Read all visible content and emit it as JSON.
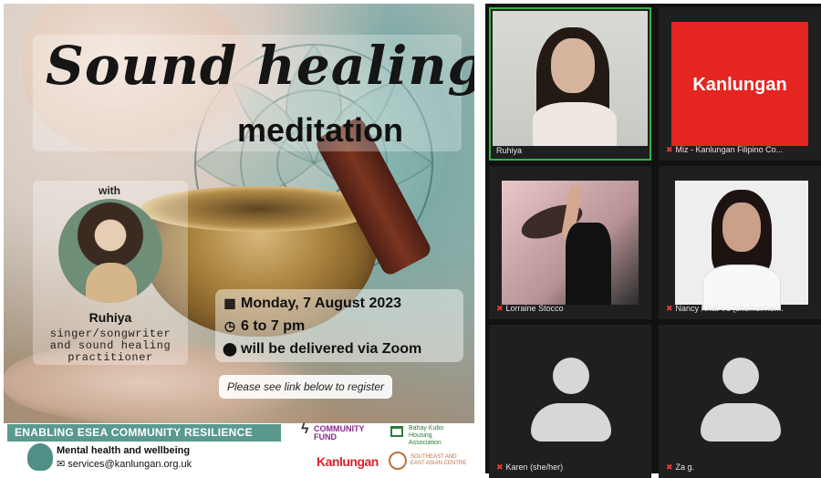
{
  "poster": {
    "title_script": "Sound healing",
    "title_sub": "meditation",
    "with_label": "with",
    "host_name": "Ruhiya",
    "host_role_lines": [
      "singer/songwriter",
      "and sound healing",
      "practitioner"
    ],
    "details": {
      "date": "Monday, 7 August 2023",
      "time": "6 to 7 pm",
      "location": "will be delivered via Zoom"
    },
    "register_note": "Please see link below to register",
    "banner": "ENABLING ESEA COMMUNITY RESILIENCE",
    "footer_title": "Mental health and wellbeing",
    "footer_email": "services@kanlungan.org.uk",
    "logos": {
      "community_fund": [
        "COMMUNITY",
        "FUND"
      ],
      "bahay_kubo": [
        "Bahay Kubo",
        "Housing",
        "Association"
      ],
      "kanlungan": "Kanlungan",
      "esea_centre": [
        "SOUTHEAST AND",
        "EAST ASIAN CENTRE"
      ]
    },
    "colors": {
      "banner": "#5a9a8e",
      "kanlungan_red": "#d9232d"
    }
  },
  "zoom": {
    "participants": [
      {
        "name": "Ruhiya",
        "muted": false,
        "active": true
      },
      {
        "name": "Miz - Kanlungan Filipino Co...",
        "muted": true,
        "tile_text": "Kanlungan"
      },
      {
        "name": "Lorraine Stocco",
        "muted": true
      },
      {
        "name": "Nancy Nhat Vu (she/her/her...",
        "muted": true
      },
      {
        "name": "Karen (she/her)",
        "muted": true
      },
      {
        "name": "Za g.",
        "muted": true
      }
    ],
    "colors": {
      "active_border": "#34b34a",
      "muted_icon": "#e23b3b",
      "kanlungan_tile": "#e52521"
    }
  }
}
